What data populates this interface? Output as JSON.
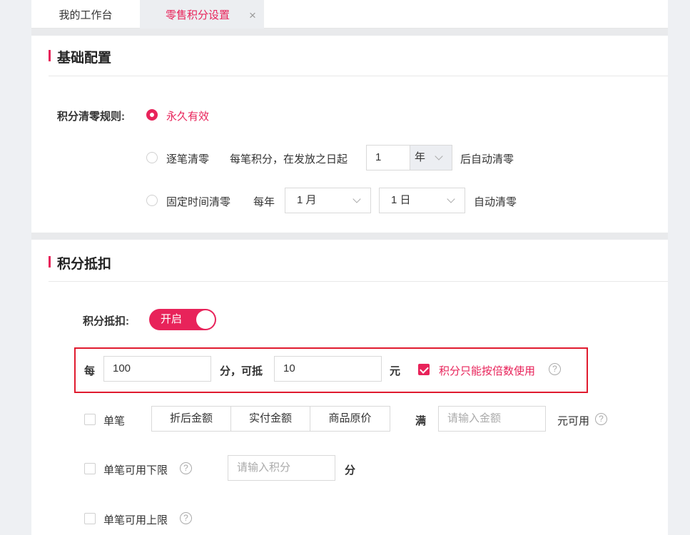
{
  "tabs": {
    "home": "我的工作台",
    "active": "零售积分设置",
    "close_glyph": "×"
  },
  "basic": {
    "title": "基础配置",
    "clear_rule_label": "积分清零规则:",
    "opt_permanent": "永久有效",
    "opt_per_record": "逐笔清零",
    "per_record_text": "每笔积分，在发放之日起",
    "per_record_value": "1",
    "per_record_unit": "年",
    "per_record_suffix": "后自动清零",
    "opt_fixed": "固定时间清零",
    "fixed_prefix": "每年",
    "fixed_month": "1 月",
    "fixed_day": "1 日",
    "fixed_suffix": "自动清零",
    "selected": "permanent"
  },
  "deduct": {
    "title": "积分抵扣",
    "switch_label": "积分抵扣:",
    "switch_text": "开启",
    "switch_on": true,
    "every": "每",
    "points_value": "100",
    "points_mid": "分，可抵",
    "yuan_value": "10",
    "yuan_unit": "元",
    "multiple_label": "积分只能按倍数使用",
    "multiple_checked": true,
    "single": {
      "label": "单笔",
      "segments": [
        "折后金额",
        "实付金额",
        "商品原价"
      ],
      "full": "满",
      "amount_placeholder": "请输入金额",
      "suffix": "元可用"
    },
    "lower": {
      "label": "单笔可用下限",
      "placeholder": "请输入积分",
      "unit": "分"
    },
    "upper": {
      "label": "单笔可用上限"
    },
    "help_glyph": "?"
  },
  "colors": {
    "accent": "#e8235a",
    "highlight_frame": "#e01b2f"
  }
}
